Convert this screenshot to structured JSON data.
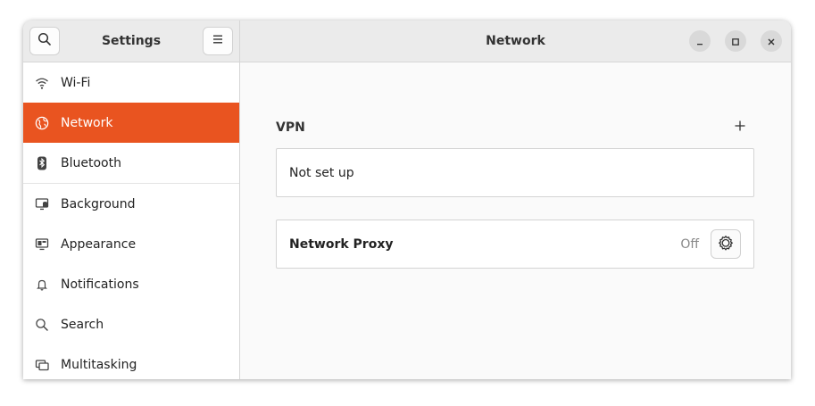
{
  "window": {
    "sidebar_title": "Settings",
    "page_title": "Network"
  },
  "header": {
    "search_icon": "search-icon",
    "menu_icon": "hamburger-menu-icon",
    "controls": [
      "minimize",
      "maximize",
      "close"
    ]
  },
  "sidebar": {
    "items": [
      {
        "label": "Wi-Fi",
        "icon": "wifi-icon",
        "active": false
      },
      {
        "label": "Network",
        "icon": "globe-icon",
        "active": true
      },
      {
        "label": "Bluetooth",
        "icon": "bluetooth-icon",
        "active": false
      },
      {
        "label": "Background",
        "icon": "background-icon",
        "active": false
      },
      {
        "label": "Appearance",
        "icon": "appearance-icon",
        "active": false
      },
      {
        "label": "Notifications",
        "icon": "bell-icon",
        "active": false
      },
      {
        "label": "Search",
        "icon": "search-icon",
        "active": false
      },
      {
        "label": "Multitasking",
        "icon": "multitasking-icon",
        "active": false
      }
    ]
  },
  "main": {
    "vpn": {
      "label": "VPN",
      "empty_text": "Not set up"
    },
    "proxy": {
      "label": "Network Proxy",
      "status": "Off"
    }
  },
  "colors": {
    "accent": "#e95420",
    "header_bg": "#ebebeb",
    "content_bg": "#fafafa"
  }
}
